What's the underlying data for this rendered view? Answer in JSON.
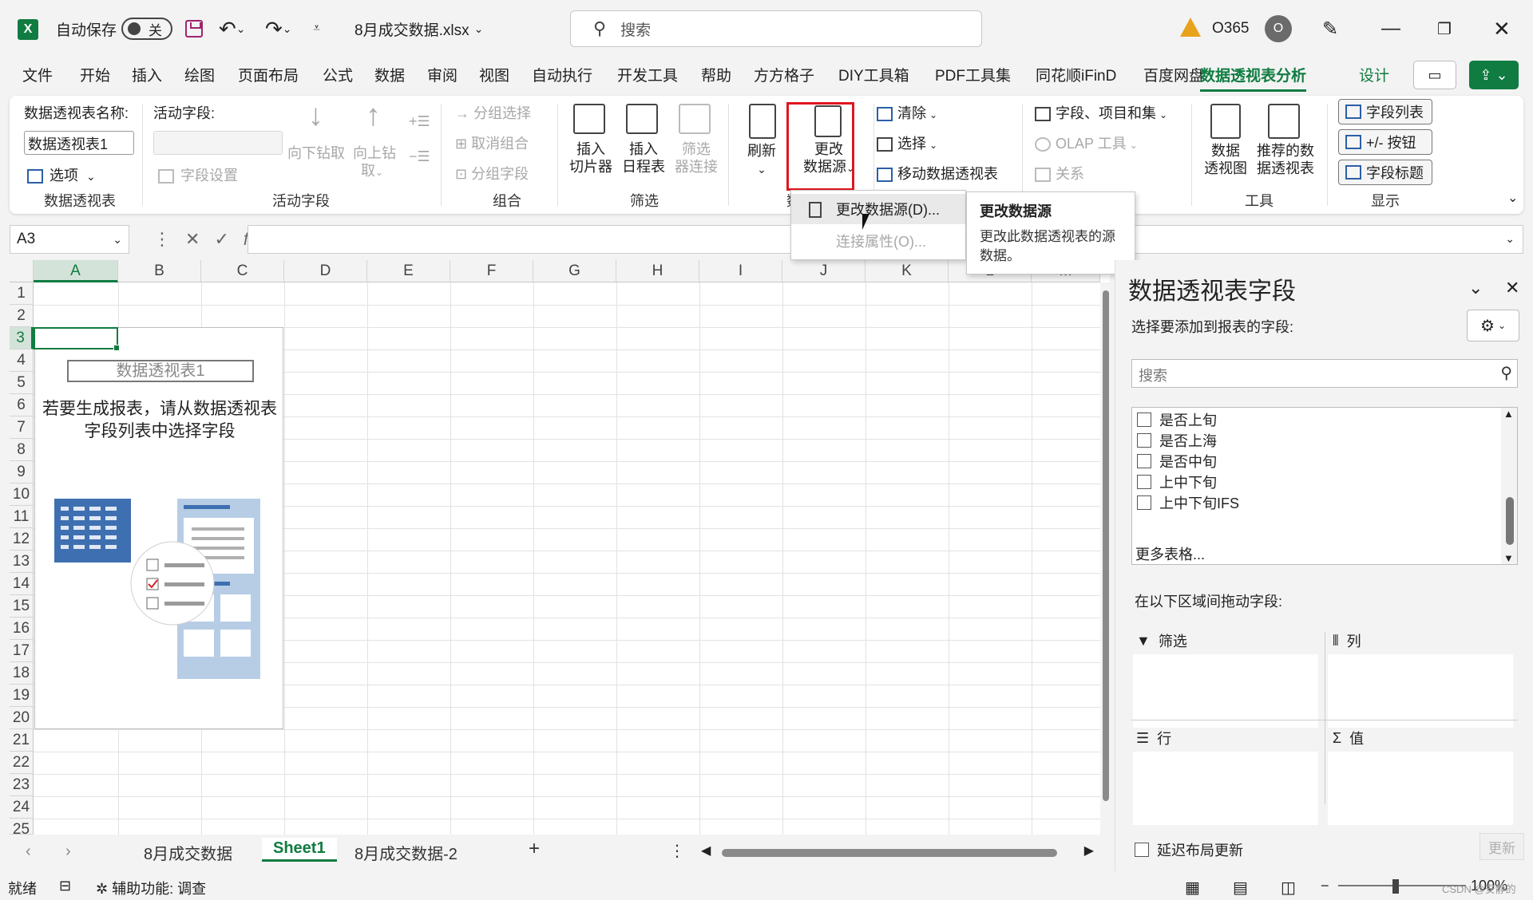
{
  "titlebar": {
    "app_icon": "X",
    "autosave_label": "自动保存",
    "autosave_state": "关",
    "filename": "8月成交数据.xlsx",
    "search_placeholder": "搜索",
    "account": "O365",
    "avatar_letter": "O"
  },
  "menu": {
    "tabs": [
      "文件",
      "开始",
      "插入",
      "绘图",
      "页面布局",
      "公式",
      "数据",
      "审阅",
      "视图",
      "自动执行",
      "开发工具",
      "帮助",
      "方方格子",
      "DIY工具箱",
      "PDF工具集",
      "同花顺iFinD",
      "百度网盘",
      "数据透视表分析",
      "设计"
    ],
    "active_tab": "数据透视表分析"
  },
  "ribbon": {
    "pivot_name_label": "数据透视表名称:",
    "pivot_name_value": "数据透视表1",
    "options": "选项",
    "group_pivot": "数据透视表",
    "active_field_label": "活动字段:",
    "field_settings": "字段设置",
    "drill_down": "向下钻取",
    "drill_up_1": "向上钻",
    "drill_up_2": "取",
    "group_active_field": "活动字段",
    "group_selection": "分组选择",
    "ungroup": "取消组合",
    "group_field": "分组字段",
    "group_group": "组合",
    "insert_slicer_1": "插入",
    "insert_slicer_2": "切片器",
    "insert_timeline_1": "插入",
    "insert_timeline_2": "日程表",
    "filter_conn_1": "筛选",
    "filter_conn_2": "器连接",
    "group_filter": "筛选",
    "refresh": "刷新",
    "change_source_1": "更改",
    "change_source_2": "数据源",
    "group_data": "数",
    "clear": "清除",
    "select": "选择",
    "move_pivot": "移动数据透视表",
    "fields_items_sets": "字段、项目和集",
    "olap_tools": "OLAP 工具",
    "relationships": "关系",
    "pivot_chart_1": "数据",
    "pivot_chart_2": "透视图",
    "recommended_1": "推荐的数",
    "recommended_2": "据透视表",
    "group_tools": "工具",
    "field_list": "字段列表",
    "plus_minus": "+/- 按钮",
    "field_headers": "字段标题",
    "group_show": "显示"
  },
  "formula_bar": {
    "name_box": "A3",
    "fx": "fx"
  },
  "grid": {
    "columns": [
      "A",
      "B",
      "C",
      "D",
      "E",
      "F",
      "G",
      "H",
      "I",
      "J",
      "K",
      "L",
      "M"
    ],
    "rows": [
      "1",
      "2",
      "3",
      "4",
      "5",
      "6",
      "7",
      "8",
      "9",
      "10",
      "11",
      "12",
      "13",
      "14",
      "15",
      "16",
      "17",
      "18",
      "19",
      "20",
      "21",
      "22",
      "23",
      "24",
      "25"
    ],
    "selected_cell": "A3",
    "pivot_placeholder_name": "数据透视表1",
    "pivot_message": "若要生成报表，请从数据透视表字段列表中选择字段"
  },
  "dropdown": {
    "items": [
      {
        "label": "更改数据源(D)...",
        "enabled": true
      },
      {
        "label": "连接属性(O)...",
        "enabled": false
      }
    ]
  },
  "tooltip": {
    "title": "更改数据源",
    "body": "更改此数据透视表的源数据。"
  },
  "sheets": {
    "tabs": [
      "8月成交数据",
      "Sheet1",
      "8月成交数据-2"
    ],
    "active": "Sheet1"
  },
  "statusbar": {
    "ready": "就绪",
    "accessibility": "辅助功能: 调查",
    "zoom": "100%",
    "watermark": "CSDN @安静的"
  },
  "panel": {
    "title": "数据透视表字段",
    "subtitle": "选择要添加到报表的字段:",
    "search_placeholder": "搜索",
    "fields": [
      "是否上旬",
      "是否上海",
      "是否中旬",
      "上中下旬",
      "上中下旬IFS"
    ],
    "more_tables": "更多表格...",
    "drag_label": "在以下区域间拖动字段:",
    "areas": {
      "filter": "筛选",
      "columns": "列",
      "rows": "行",
      "values": "值"
    },
    "defer_update": "延迟布局更新",
    "update_button": "更新"
  },
  "colors": {
    "accent": "#107c41",
    "highlight": "#e0161f",
    "warning": "#e8a21b"
  }
}
